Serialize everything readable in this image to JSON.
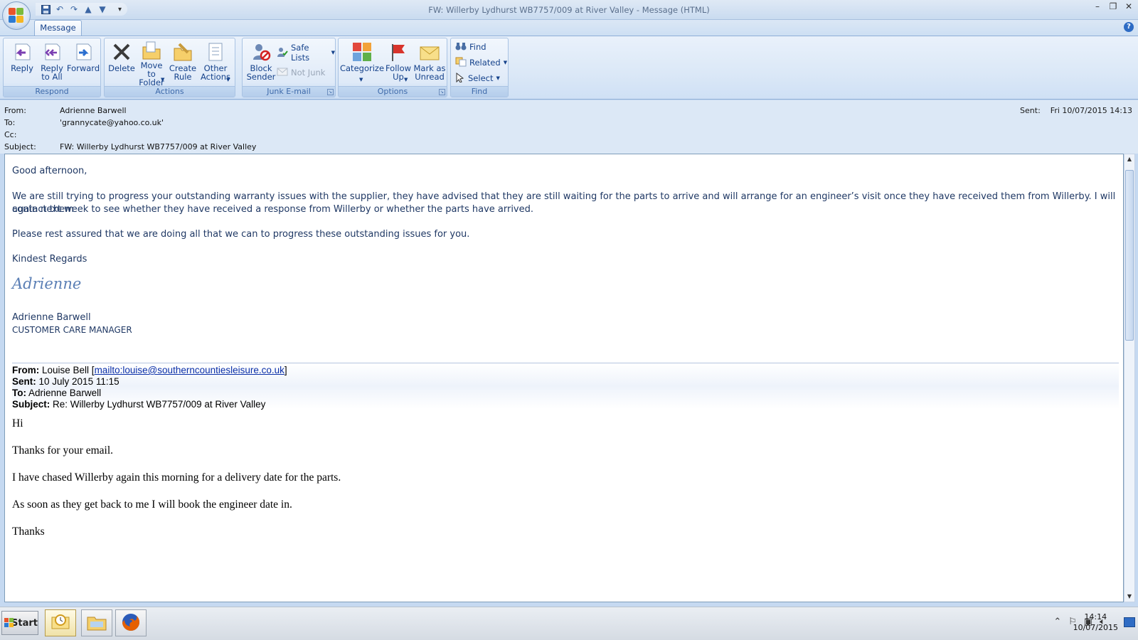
{
  "window": {
    "title": "FW: Willerby Lydhurst WB7757/009 at River Valley - Message (HTML)",
    "controls": [
      "–",
      "❐",
      "✕"
    ]
  },
  "qat": {
    "more": "▾"
  },
  "tabs": {
    "message": "Message"
  },
  "ribbon": {
    "respond": {
      "label": "Respond",
      "reply": "Reply",
      "reply_all": "Reply\nto All",
      "forward": "Forward"
    },
    "actions": {
      "label": "Actions",
      "delete": "Delete",
      "move_to_folder": "Move to\nFolder",
      "create_rule": "Create\nRule",
      "other_actions": "Other\nActions"
    },
    "junk": {
      "label": "Junk E-mail",
      "block_sender": "Block\nSender",
      "safe_lists": "Safe Lists",
      "not_junk": "Not Junk"
    },
    "options": {
      "label": "Options",
      "categorize": "Categorize",
      "follow_up": "Follow\nUp",
      "mark_unread": "Mark as\nUnread"
    },
    "find": {
      "label": "Find",
      "find": "Find",
      "related": "Related",
      "select": "Select"
    }
  },
  "header": {
    "from_label": "From:",
    "from": "Adrienne Barwell",
    "to_label": "To:",
    "to": "'grannycate@yahoo.co.uk'",
    "cc_label": "Cc:",
    "cc": "",
    "subject_label": "Subject:",
    "subject": "FW: Willerby Lydhurst WB7757/009 at River Valley",
    "sent_label": "Sent:",
    "sent": "Fri 10/07/2015 14:13"
  },
  "body": {
    "greeting": "Good afternoon,",
    "para1_line1": "We are still trying to progress your outstanding warranty issues with the supplier, they have advised that they are still waiting for the parts to arrive and will arrange for an engineer’s visit once they have received them from Willerby.    I will  contact them",
    "para1_line2": "again next week to see whether they have received a response from Willerby or whether the parts have arrived.",
    "para2": "Please rest assured that we are doing all that we can to progress these outstanding issues for you.",
    "regards": "Kindest Regards",
    "signature": "Adrienne",
    "sig_name": "Adrienne Barwell",
    "sig_title": "CUSTOMER CARE MANAGER"
  },
  "forwarded": {
    "from_label": "From:",
    "from_name": "Louise Bell [",
    "from_link": "mailto:louise@southerncountiesleisure.co.uk",
    "from_close": "]",
    "sent_label": "Sent:",
    "sent": "10 July 2015 11:15",
    "to_label": "To:",
    "to": "Adrienne Barwell",
    "subject_label": "Subject:",
    "subject": "Re: Willerby Lydhurst WB7757/009 at River Valley",
    "hi": "Hi",
    "thanks_email": "Thanks for your email.",
    "chased": "I have chased Willerby again this morning for a delivery date for the parts.",
    "book": "As soon as they get back to me I will book the engineer date in.",
    "thanks": "Thanks"
  },
  "taskbar": {
    "start": "Start",
    "time": "14:14",
    "date": "10/07/2015"
  }
}
